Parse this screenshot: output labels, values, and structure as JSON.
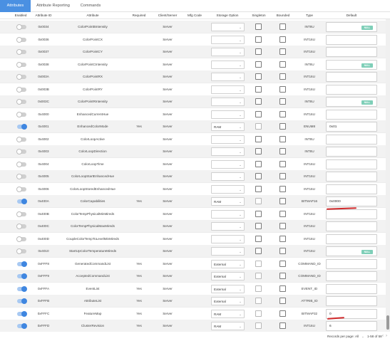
{
  "tabs": [
    {
      "label": "Attributes"
    },
    {
      "label": "Attribute Reporting"
    },
    {
      "label": "Commands"
    }
  ],
  "columns": {
    "enabled": "Enabled",
    "attribute_id": "Attribute ID",
    "attribute": "Attribute",
    "required": "Required",
    "client_server": "Client/Server",
    "mfg_code": "Mfg Code",
    "storage_option": "Storage Option",
    "singleton": "Singleton",
    "bounded": "Bounded",
    "type": "Type",
    "default": "Default"
  },
  "select_chevron": "⌄",
  "null_label": "NULL",
  "rows": [
    {
      "enabled": false,
      "id": "0x0034",
      "name": "ColorPointBIntensity",
      "required": "",
      "side": "Server",
      "storage": "",
      "type": "INT8U",
      "default": "",
      "null_btn": true
    },
    {
      "enabled": false,
      "id": "0x0036",
      "name": "ColorPointCX",
      "required": "",
      "side": "Server",
      "storage": "",
      "type": "INT16U",
      "default": "",
      "null_btn": false
    },
    {
      "enabled": false,
      "id": "0x0037",
      "name": "ColorPointCY",
      "required": "",
      "side": "Server",
      "storage": "",
      "type": "INT16U",
      "default": "",
      "null_btn": false
    },
    {
      "enabled": false,
      "id": "0x0038",
      "name": "ColorPointCIntensity",
      "required": "",
      "side": "Server",
      "storage": "",
      "type": "INT8U",
      "default": "",
      "null_btn": true
    },
    {
      "enabled": false,
      "id": "0x003A",
      "name": "ColorPointRX",
      "required": "",
      "side": "Server",
      "storage": "",
      "type": "INT16U",
      "default": "",
      "null_btn": false
    },
    {
      "enabled": false,
      "id": "0x003B",
      "name": "ColorPointRY",
      "required": "",
      "side": "Server",
      "storage": "",
      "type": "INT16U",
      "default": "",
      "null_btn": false
    },
    {
      "enabled": false,
      "id": "0x003C",
      "name": "ColorPointRIntensity",
      "required": "",
      "side": "Server",
      "storage": "",
      "type": "INT8U",
      "default": "",
      "null_btn": true
    },
    {
      "enabled": false,
      "id": "0x4000",
      "name": "EnhancedCurrentHue",
      "required": "",
      "side": "Server",
      "storage": "",
      "type": "INT16U",
      "default": "",
      "null_btn": false
    },
    {
      "enabled": true,
      "id": "0x4001",
      "name": "EnhancedColorMode",
      "required": "Yes",
      "side": "Server",
      "storage": "RAM",
      "type": "ENUM8",
      "default": "0x01",
      "null_btn": false
    },
    {
      "enabled": false,
      "id": "0x4002",
      "name": "ColorLoopActive",
      "required": "",
      "side": "Server",
      "storage": "",
      "type": "INT8U",
      "default": "",
      "null_btn": false
    },
    {
      "enabled": false,
      "id": "0x4003",
      "name": "ColorLoopDirection",
      "required": "",
      "side": "Server",
      "storage": "",
      "type": "INT8U",
      "default": "",
      "null_btn": false
    },
    {
      "enabled": false,
      "id": "0x4004",
      "name": "ColorLoopTime",
      "required": "",
      "side": "Server",
      "storage": "",
      "type": "INT16U",
      "default": "",
      "null_btn": false
    },
    {
      "enabled": false,
      "id": "0x4005",
      "name": "ColorLoopStartEnhancedHue",
      "required": "",
      "side": "Server",
      "storage": "",
      "type": "INT16U",
      "default": "",
      "null_btn": false
    },
    {
      "enabled": false,
      "id": "0x4006",
      "name": "ColorLoopStoredEnhancedHue",
      "required": "",
      "side": "Server",
      "storage": "",
      "type": "INT16U",
      "default": "",
      "null_btn": false
    },
    {
      "enabled": true,
      "id": "0x400A",
      "name": "ColorCapabilities",
      "required": "Yes",
      "side": "Server",
      "storage": "RAM",
      "type": "BITMAP16",
      "default": "0x0000",
      "null_btn": false
    },
    {
      "enabled": false,
      "id": "0x400B",
      "name": "ColorTempPhysicalMinMireds",
      "required": "",
      "side": "Server",
      "storage": "",
      "type": "INT16U",
      "default": "",
      "null_btn": false
    },
    {
      "enabled": false,
      "id": "0x400C",
      "name": "ColorTempPhysicalMaxMireds",
      "required": "",
      "side": "Server",
      "storage": "",
      "type": "INT16U",
      "default": "",
      "null_btn": false
    },
    {
      "enabled": false,
      "id": "0x400D",
      "name": "CoupleColorTempToLevelMinMireds",
      "required": "",
      "side": "Server",
      "storage": "",
      "type": "INT16U",
      "default": "",
      "null_btn": false
    },
    {
      "enabled": false,
      "id": "0x4010",
      "name": "StartUpColorTemperatureMireds",
      "required": "",
      "side": "Server",
      "storage": "",
      "type": "INT16U",
      "default": "",
      "null_btn": true
    },
    {
      "enabled": true,
      "id": "0xFFF8",
      "name": "GeneratedCommandList",
      "required": "Yes",
      "side": "Server",
      "storage": "External",
      "type": "COMMAND_ID",
      "default": "",
      "null_btn": false
    },
    {
      "enabled": true,
      "id": "0xFFF9",
      "name": "AcceptedCommandList",
      "required": "Yes",
      "side": "Server",
      "storage": "External",
      "type": "COMMAND_ID",
      "default": "",
      "null_btn": false
    },
    {
      "enabled": true,
      "id": "0xFFFA",
      "name": "EventList",
      "required": "Yes",
      "side": "Server",
      "storage": "External",
      "type": "EVENT_ID",
      "default": "",
      "null_btn": false
    },
    {
      "enabled": true,
      "id": "0xFFFB",
      "name": "AttributeList",
      "required": "Yes",
      "side": "Server",
      "storage": "External",
      "type": "ATTRIB_ID",
      "default": "",
      "null_btn": false
    },
    {
      "enabled": true,
      "id": "0xFFFC",
      "name": "FeatureMap",
      "required": "Yes",
      "side": "Server",
      "storage": "RAM",
      "type": "BITMAP32",
      "default": "0",
      "null_btn": false
    },
    {
      "enabled": true,
      "id": "0xFFFD",
      "name": "ClusterRevision",
      "required": "Yes",
      "side": "Server",
      "storage": "RAM",
      "type": "INT16U",
      "default": "6",
      "null_btn": false
    }
  ],
  "footer": {
    "records_label": "Records per page:",
    "records_value": "All",
    "records_chevron": "⌄",
    "range": "1-58 of 58",
    "prev": "‹",
    "next": "›"
  },
  "colors": {
    "accent": "#4a90e2",
    "toggle_on": "#3f86e0",
    "null_button": "#7fcfb8",
    "annotation_red": "#d0282a"
  }
}
